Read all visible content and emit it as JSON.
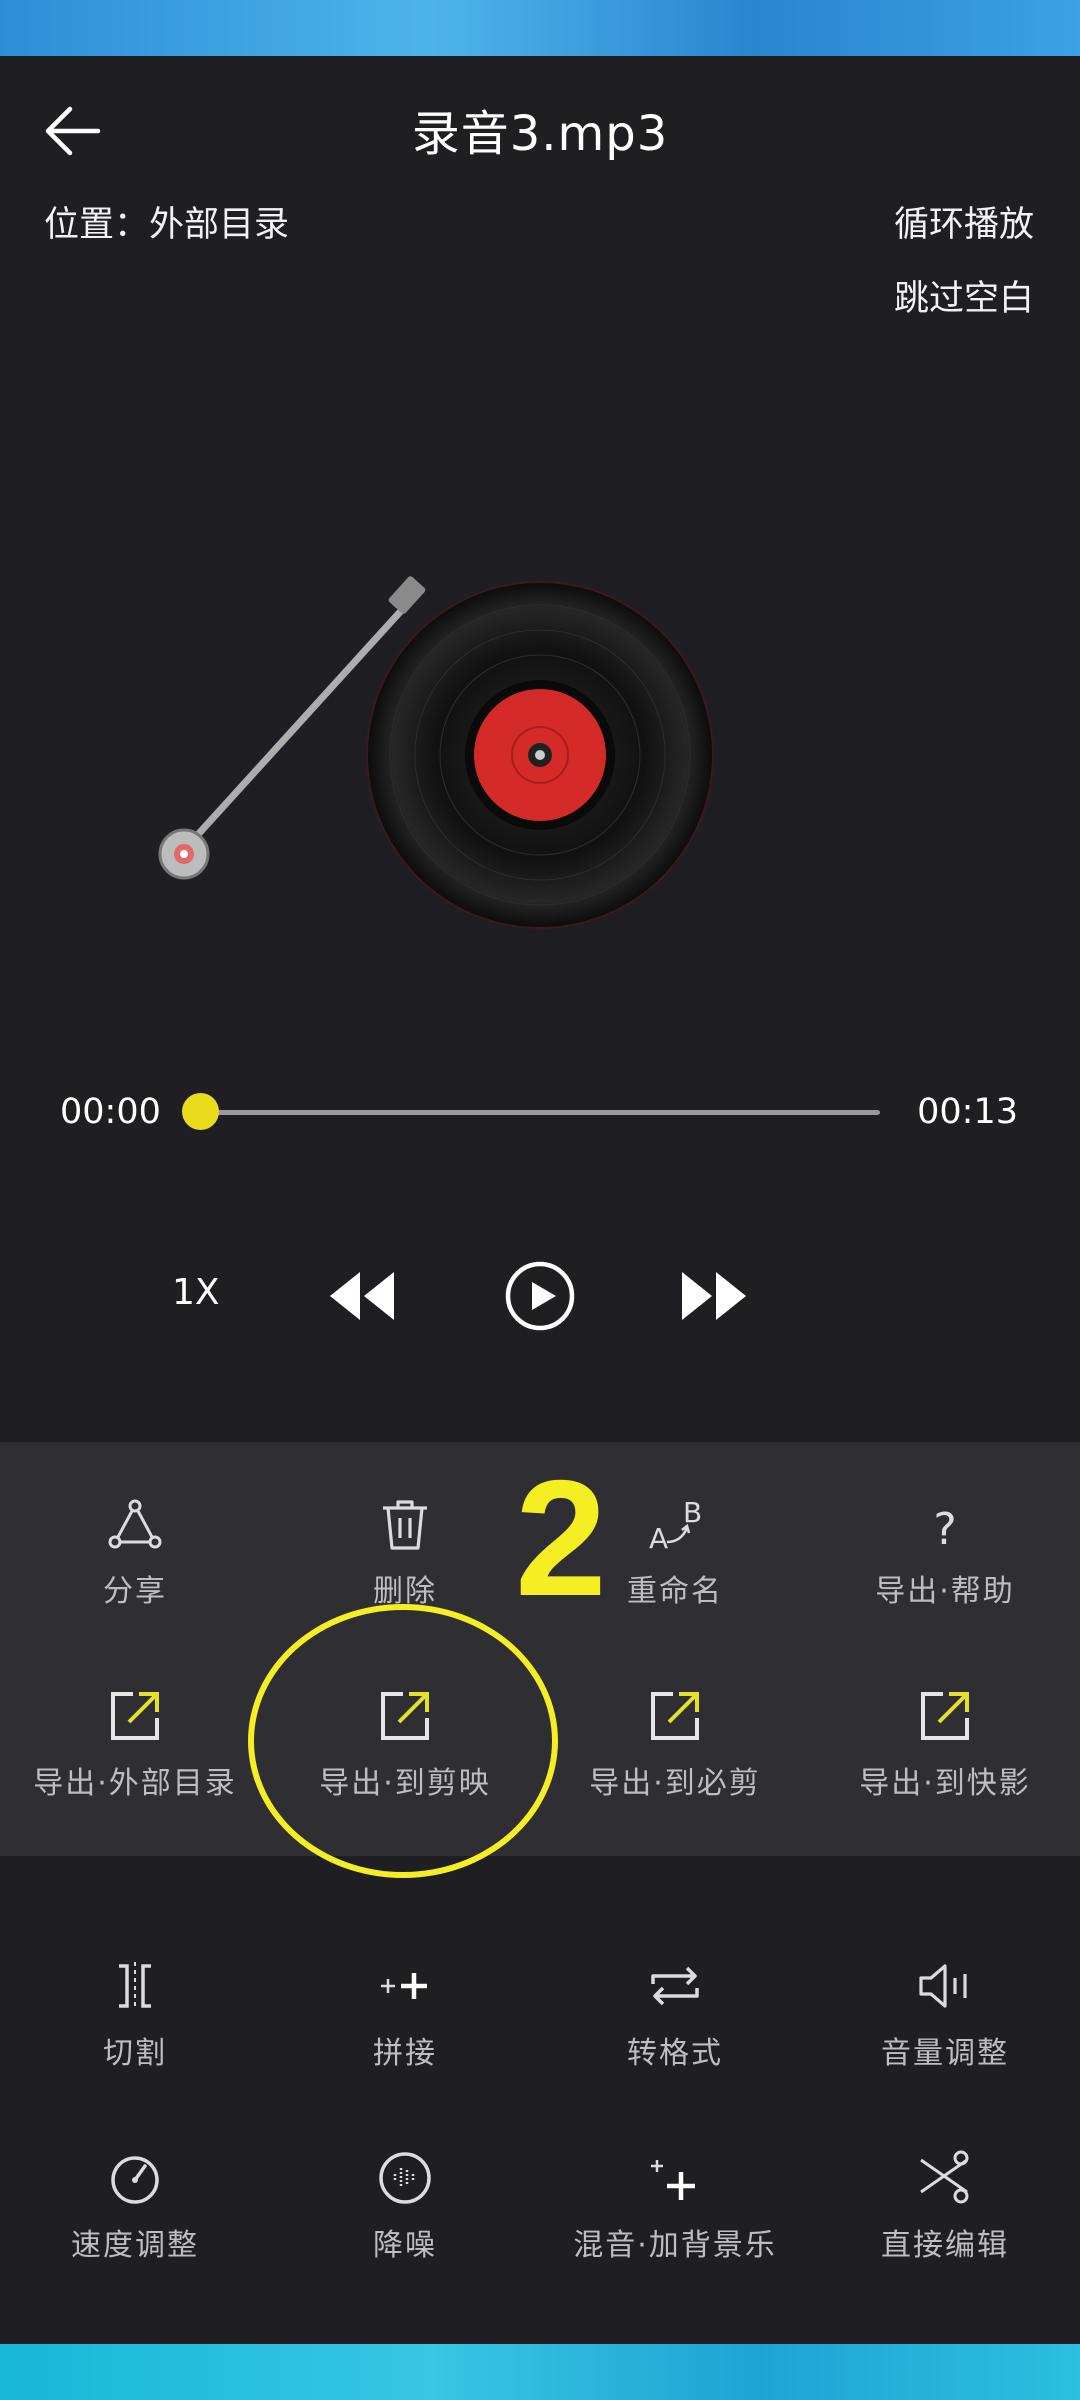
{
  "header": {
    "title": "录音3.mp3",
    "location": "位置：外部目录",
    "loop_label": "循环播放",
    "skip_silence_label": "跳过空白"
  },
  "progress": {
    "current": "00:00",
    "total": "00:13",
    "fraction": 0.0
  },
  "controls": {
    "speed": "1X",
    "icons": [
      "rewind-icon",
      "play-icon",
      "fast-forward-icon"
    ]
  },
  "actions": [
    {
      "label": "分享",
      "icon": "share-icon"
    },
    {
      "label": "删除",
      "icon": "trash-icon"
    },
    {
      "label": "重命名",
      "icon": "rename-icon"
    },
    {
      "label": "导出·帮助",
      "icon": "help-icon"
    },
    {
      "label": "导出·外部目录",
      "icon": "export-icon"
    },
    {
      "label": "导出·到剪映",
      "icon": "export-icon"
    },
    {
      "label": "导出·到必剪",
      "icon": "export-icon"
    },
    {
      "label": "导出·到快影",
      "icon": "export-icon"
    }
  ],
  "tools": [
    {
      "label": "切割",
      "icon": "cut-icon"
    },
    {
      "label": "拼接",
      "icon": "join-icon"
    },
    {
      "label": "转格式",
      "icon": "convert-icon"
    },
    {
      "label": "音量调整",
      "icon": "volume-icon"
    },
    {
      "label": "速度调整",
      "icon": "speed-icon"
    },
    {
      "label": "降噪",
      "icon": "denoise-icon"
    },
    {
      "label": "混音·加背景乐",
      "icon": "mix-icon"
    },
    {
      "label": "直接编辑",
      "icon": "edit-icon"
    }
  ],
  "annotation": {
    "step": "2"
  },
  "colors": {
    "background": "#1f1f23",
    "panel": "#2f2f33",
    "accent_yellow": "#eadc1d",
    "export_arrow": "#e5e02a",
    "record_label": "#d42a28"
  }
}
